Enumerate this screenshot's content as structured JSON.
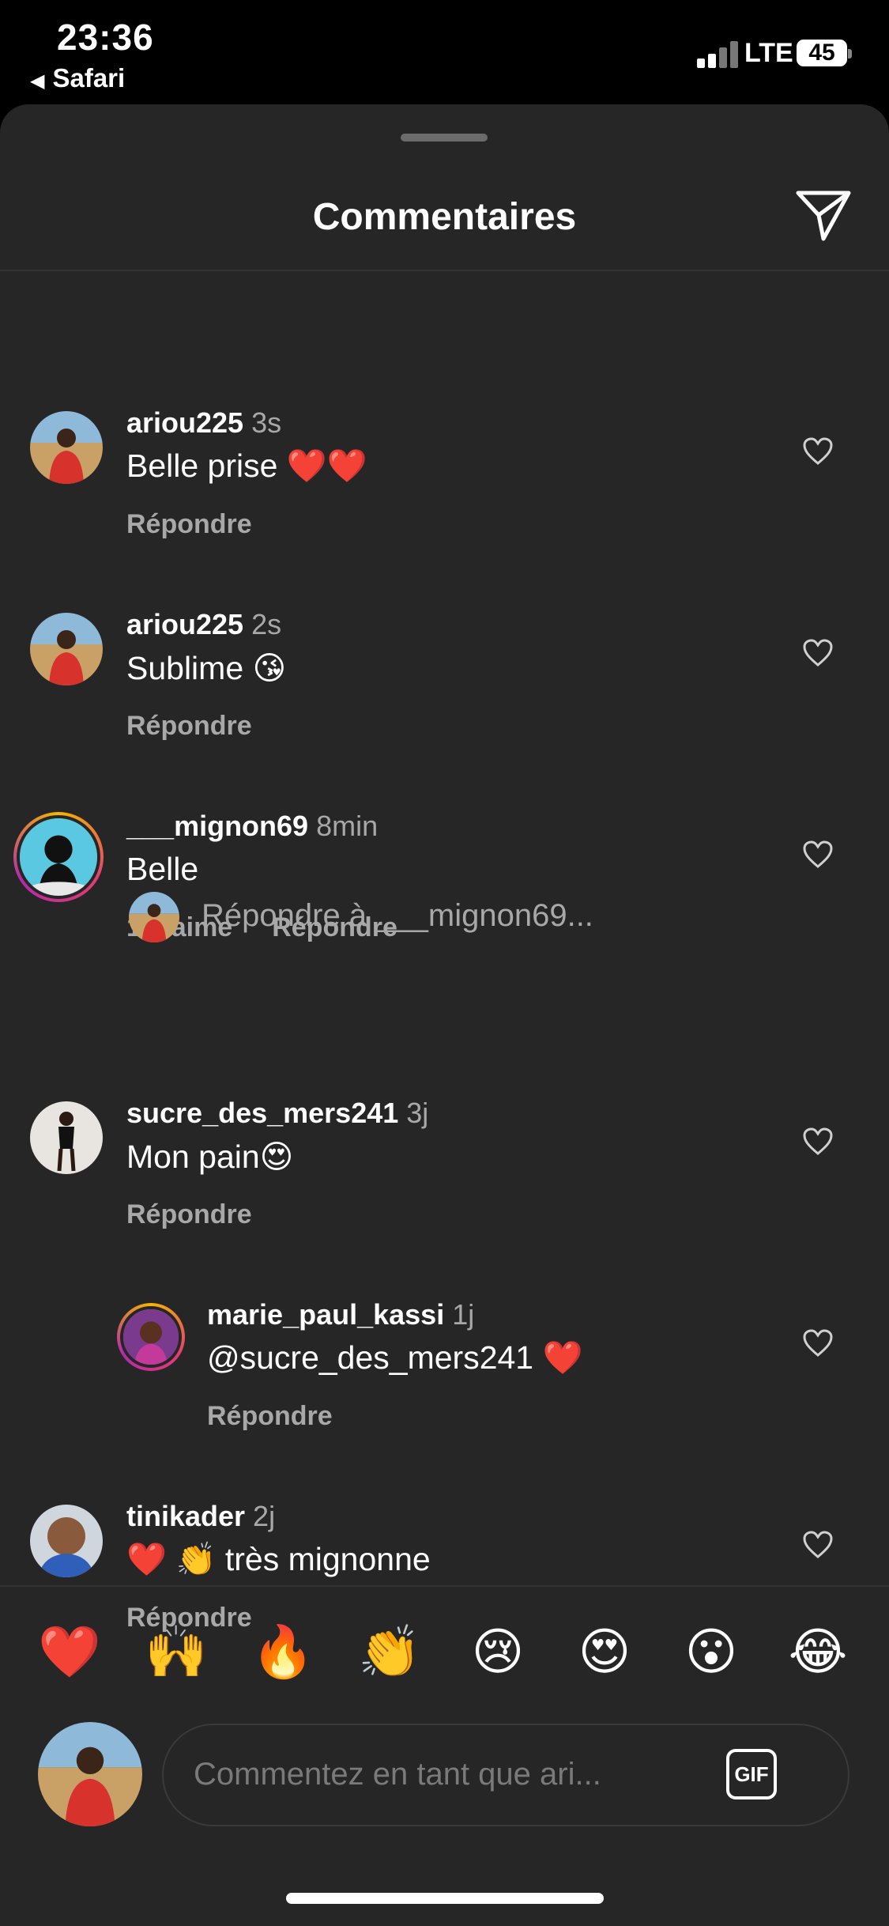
{
  "status_bar": {
    "time": "23:36",
    "back_label": "Safari",
    "network": "LTE",
    "battery": "45"
  },
  "sheet": {
    "title": "Commentaires"
  },
  "comments": [
    {
      "username": "ariou225",
      "time": "3s",
      "text": "Belle prise ❤️❤️",
      "actions": [
        "Répondre"
      ]
    },
    {
      "username": "ariou225",
      "time": "2s",
      "text": "Sublime 😘",
      "actions": [
        "Répondre"
      ]
    },
    {
      "username": "___mignon69",
      "time": "8min",
      "text": "Belle",
      "actions": [
        "1 J’aime",
        "Répondre"
      ]
    },
    {
      "username": "sucre_des_mers241",
      "time": "3j",
      "text": "Mon pain😍",
      "actions": [
        "Répondre"
      ]
    },
    {
      "username": "marie_paul_kassi",
      "time": "1j",
      "text": "@sucre_des_mers241 ❤️",
      "actions": [
        "Répondre"
      ]
    },
    {
      "username": "tinikader",
      "time": "2j",
      "text": "❤️ 👏 très mignonne",
      "actions": [
        "Répondre"
      ]
    }
  ],
  "reply_prompt": "Répondre à ___mignon69...",
  "emoji_bar": [
    "❤️",
    "🙌",
    "🔥",
    "👏",
    "😢",
    "😍",
    "😮",
    "😂"
  ],
  "composer": {
    "placeholder": "Commentez en tant que ari...",
    "gif_label": "GIF"
  },
  "colors": {
    "background": "#262626",
    "secondary_text": "#a8a8a8",
    "heart_red": "#e0222a"
  }
}
